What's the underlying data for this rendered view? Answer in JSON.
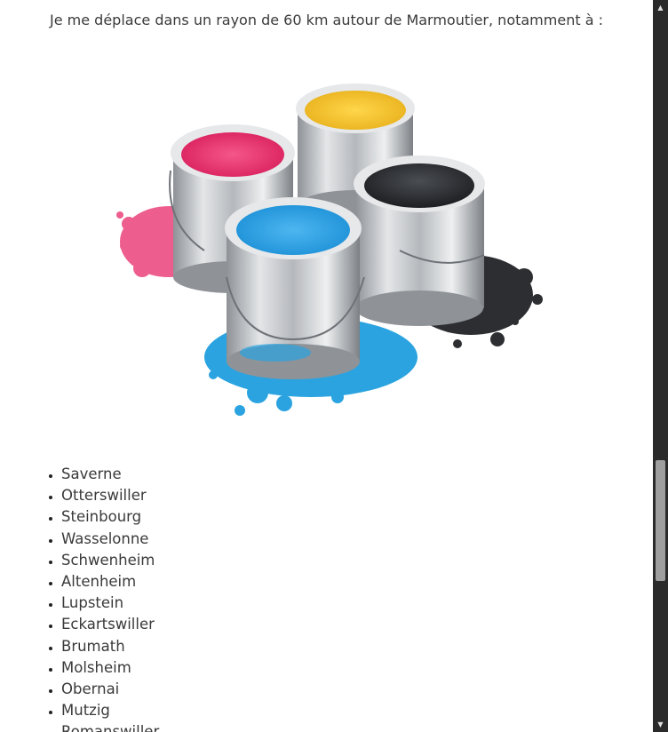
{
  "intro": {
    "text": "Je me déplace dans un rayon de 60 km autour de Marmoutier, notamment à :"
  },
  "image": {
    "description_icon": "paint-cans-image",
    "colors": {
      "magenta": "#e8386b",
      "yellow": "#f5c531",
      "black": "#2c2e31",
      "cyan": "#2aa3e0",
      "metal": "#c9ccd0"
    }
  },
  "towns": [
    "Saverne",
    "Otterswiller",
    "Steinbourg",
    "Wasselonne",
    "Schwenheim",
    "Altenheim",
    "Lupstein",
    "Eckartswiller",
    "Brumath",
    "Molsheim",
    "Obernai",
    "Mutzig",
    "Romanswiller"
  ],
  "scrollbar": {
    "up_icon": "▲",
    "down_icon": "▼"
  }
}
